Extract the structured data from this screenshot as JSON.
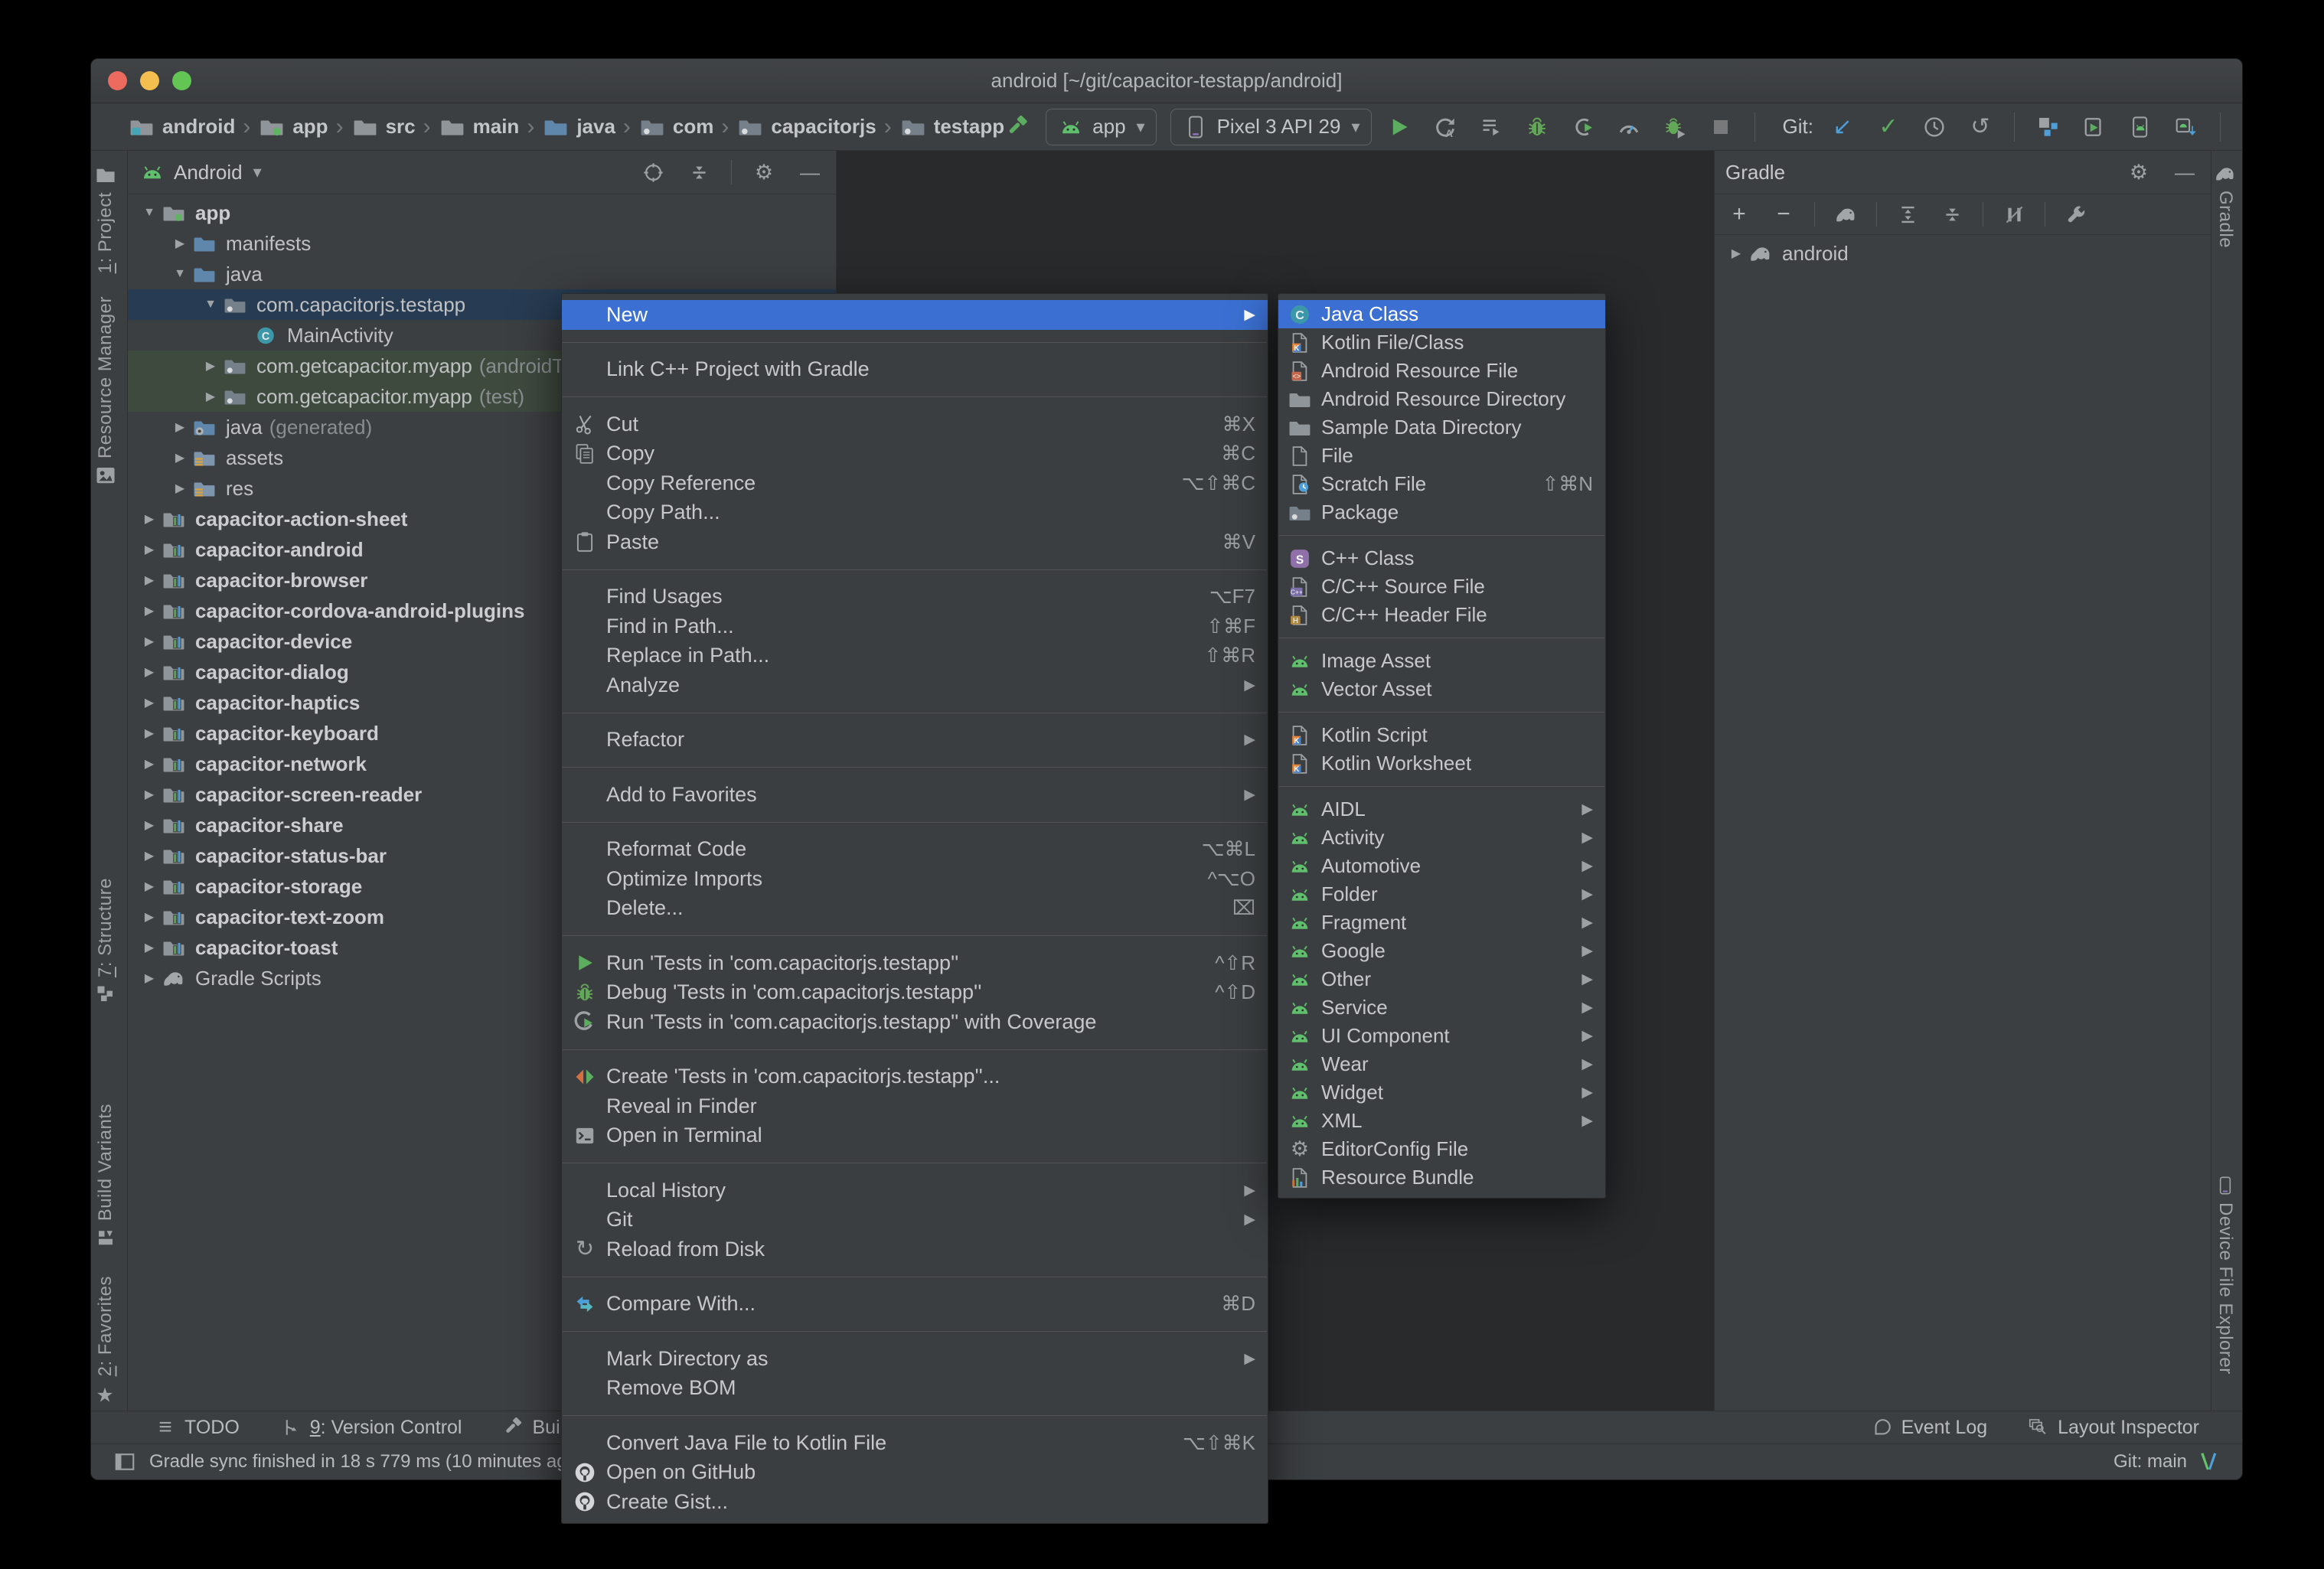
{
  "window": {
    "title": "android [~/git/capacitor-testapp/android]"
  },
  "breadcrumbs": [
    {
      "label": "android",
      "icon": "project-folder"
    },
    {
      "label": "app",
      "icon": "module-folder"
    },
    {
      "label": "src",
      "icon": "folder"
    },
    {
      "label": "main",
      "icon": "folder"
    },
    {
      "label": "java",
      "icon": "folder-blue"
    },
    {
      "label": "com",
      "icon": "package"
    },
    {
      "label": "capacitorjs",
      "icon": "package"
    },
    {
      "label": "testapp",
      "icon": "package"
    }
  ],
  "run_toolbar": {
    "config_label": "app",
    "device_label": "Pixel 3 API 29",
    "git_label": "Git:",
    "actions": [
      {
        "name": "run",
        "icon": "play"
      },
      {
        "name": "apply-changes",
        "icon": "apply"
      },
      {
        "name": "apply-code-changes",
        "icon": "list-restart"
      },
      {
        "name": "debug",
        "icon": "debug-bug"
      },
      {
        "name": "attach-debugger",
        "icon": "attach"
      },
      {
        "name": "profile",
        "icon": "gauge"
      },
      {
        "name": "rerun-with-coverage",
        "icon": "bug-rerun"
      },
      {
        "name": "stop",
        "icon": "stop"
      }
    ],
    "git_actions": [
      {
        "name": "update-project",
        "icon": "arrow-dl"
      },
      {
        "name": "commit",
        "icon": "check"
      },
      {
        "name": "show-history",
        "icon": "clock"
      },
      {
        "name": "rollback",
        "icon": "undo"
      }
    ],
    "tool_actions": [
      {
        "name": "project-structure",
        "icon": "structure"
      },
      {
        "name": "device-manager",
        "icon": "device-manager"
      },
      {
        "name": "avd-manager",
        "icon": "avd"
      },
      {
        "name": "sdk-manager",
        "icon": "sdk"
      }
    ]
  },
  "project_panel": {
    "title": "Android",
    "header_actions": [
      {
        "name": "select-opened-file",
        "icon": "locate"
      },
      {
        "name": "collapse-all",
        "icon": "collapse-all"
      },
      {
        "name": "settings",
        "icon": "gear"
      },
      {
        "name": "hide",
        "icon": "minimize"
      }
    ],
    "tree": [
      {
        "label": "app",
        "icon": "module-folder",
        "arrow": "down",
        "level": 0,
        "bold": true
      },
      {
        "label": "manifests",
        "icon": "folder-blue",
        "arrow": "right",
        "level": 1
      },
      {
        "label": "java",
        "icon": "folder-blue",
        "arrow": "down",
        "level": 1
      },
      {
        "label": "com.capacitorjs.testapp",
        "icon": "package",
        "arrow": "down",
        "level": 2,
        "selected": true
      },
      {
        "label": "MainActivity",
        "icon": "class",
        "level": 3
      },
      {
        "label": "com.getcapacitor.myapp",
        "suffix": "(androidTest)",
        "icon": "package",
        "arrow": "right",
        "level": 2,
        "row": "test"
      },
      {
        "label": "com.getcapacitor.myapp",
        "suffix": "(test)",
        "icon": "package",
        "arrow": "right",
        "level": 2,
        "row": "test"
      },
      {
        "label": "java",
        "suffix": "(generated)",
        "icon": "folder-gen",
        "arrow": "right",
        "level": 1
      },
      {
        "label": "assets",
        "icon": "folder-assets",
        "arrow": "right",
        "level": 1
      },
      {
        "label": "res",
        "icon": "folder-assets",
        "arrow": "right",
        "level": 1
      },
      {
        "label": "capacitor-action-sheet",
        "icon": "module",
        "arrow": "right",
        "level": 0,
        "bold": true
      },
      {
        "label": "capacitor-android",
        "icon": "module",
        "arrow": "right",
        "level": 0,
        "bold": true
      },
      {
        "label": "capacitor-browser",
        "icon": "module",
        "arrow": "right",
        "level": 0,
        "bold": true
      },
      {
        "label": "capacitor-cordova-android-plugins",
        "icon": "module",
        "arrow": "right",
        "level": 0,
        "bold": true
      },
      {
        "label": "capacitor-device",
        "icon": "module",
        "arrow": "right",
        "level": 0,
        "bold": true
      },
      {
        "label": "capacitor-dialog",
        "icon": "module",
        "arrow": "right",
        "level": 0,
        "bold": true
      },
      {
        "label": "capacitor-haptics",
        "icon": "module",
        "arrow": "right",
        "level": 0,
        "bold": true
      },
      {
        "label": "capacitor-keyboard",
        "icon": "module",
        "arrow": "right",
        "level": 0,
        "bold": true
      },
      {
        "label": "capacitor-network",
        "icon": "module",
        "arrow": "right",
        "level": 0,
        "bold": true
      },
      {
        "label": "capacitor-screen-reader",
        "icon": "module",
        "arrow": "right",
        "level": 0,
        "bold": true
      },
      {
        "label": "capacitor-share",
        "icon": "module",
        "arrow": "right",
        "level": 0,
        "bold": true
      },
      {
        "label": "capacitor-status-bar",
        "icon": "module",
        "arrow": "right",
        "level": 0,
        "bold": true
      },
      {
        "label": "capacitor-storage",
        "icon": "module",
        "arrow": "right",
        "level": 0,
        "bold": true
      },
      {
        "label": "capacitor-text-zoom",
        "icon": "module",
        "arrow": "right",
        "level": 0,
        "bold": true
      },
      {
        "label": "capacitor-toast",
        "icon": "module",
        "arrow": "right",
        "level": 0,
        "bold": true
      },
      {
        "label": "Gradle Scripts",
        "icon": "gradle-elephant",
        "arrow": "right",
        "level": 0
      }
    ]
  },
  "gradle_panel": {
    "title": "Gradle",
    "toolbar": [
      {
        "name": "refresh-add",
        "icon": "plus"
      },
      {
        "name": "detach",
        "icon": "minus"
      },
      {
        "name": "execute-task",
        "icon": "gradle-elephant"
      },
      {
        "name": "expand-all",
        "icon": "expand-all"
      },
      {
        "name": "collapse-all",
        "icon": "collapse-all"
      },
      {
        "name": "toggle-offline-mode",
        "icon": "offline"
      },
      {
        "name": "gradle-settings",
        "icon": "wrench"
      }
    ],
    "tree": [
      {
        "label": "android",
        "icon": "gradle-elephant",
        "arrow": "right",
        "level": 0
      }
    ]
  },
  "left_strip": [
    {
      "mnemonic": "1",
      "label": "Project",
      "icon": "project-tab"
    },
    {
      "label": "Resource Manager",
      "icon": "resource-tab"
    },
    {
      "mnemonic": "7",
      "label": "Structure",
      "icon": "structure-tab"
    },
    {
      "label": "Build Variants",
      "icon": "variants-tab"
    },
    {
      "mnemonic": "2",
      "label": "Favorites",
      "icon": "star"
    }
  ],
  "right_strip": [
    {
      "label": "Gradle",
      "icon": "gradle-elephant"
    },
    {
      "label": "Device File Explorer",
      "icon": "phone"
    }
  ],
  "context_menu": {
    "items": [
      {
        "label": "New",
        "submenu": true,
        "highlighted": true
      },
      {
        "sep": true
      },
      {
        "label": "Link C++ Project with Gradle"
      },
      {
        "sep": true
      },
      {
        "icon": "scissors",
        "label": "Cut",
        "shortcut": "⌘X"
      },
      {
        "icon": "copy",
        "label": "Copy",
        "shortcut": "⌘C"
      },
      {
        "label": "Copy Reference",
        "shortcut": "⌥⇧⌘C"
      },
      {
        "label": "Copy Path..."
      },
      {
        "icon": "paste",
        "label": "Paste",
        "shortcut": "⌘V"
      },
      {
        "sep": true
      },
      {
        "label": "Find Usages",
        "shortcut": "⌥F7"
      },
      {
        "label": "Find in Path...",
        "shortcut": "⇧⌘F"
      },
      {
        "label": "Replace in Path...",
        "shortcut": "⇧⌘R"
      },
      {
        "label": "Analyze",
        "submenu": true
      },
      {
        "sep": true
      },
      {
        "label": "Refactor",
        "submenu": true
      },
      {
        "sep": true
      },
      {
        "label": "Add to Favorites",
        "submenu": true
      },
      {
        "sep": true
      },
      {
        "label": "Reformat Code",
        "shortcut": "⌥⌘L"
      },
      {
        "label": "Optimize Imports",
        "shortcut": "^⌥O"
      },
      {
        "label": "Delete...",
        "shortcut": "⌧"
      },
      {
        "sep": true
      },
      {
        "icon": "run-green",
        "label": "Run 'Tests in 'com.capacitorjs.testapp''",
        "shortcut": "^⇧R"
      },
      {
        "icon": "debug-bug",
        "label": "Debug 'Tests in 'com.capacitorjs.testapp''",
        "shortcut": "^⇧D"
      },
      {
        "icon": "coverage",
        "label": "Run 'Tests in 'com.capacitorjs.testapp'' with Coverage"
      },
      {
        "sep": true
      },
      {
        "icon": "create-tests",
        "label": "Create 'Tests in 'com.capacitorjs.testapp''..."
      },
      {
        "label": "Reveal in Finder"
      },
      {
        "icon": "terminal",
        "label": "Open in Terminal"
      },
      {
        "sep": true
      },
      {
        "label": "Local History",
        "submenu": true
      },
      {
        "label": "Git",
        "submenu": true
      },
      {
        "icon": "reload",
        "label": "Reload from Disk"
      },
      {
        "sep": true
      },
      {
        "icon": "compare",
        "label": "Compare With...",
        "shortcut": "⌘D"
      },
      {
        "sep": true
      },
      {
        "label": "Mark Directory as",
        "submenu": true
      },
      {
        "label": "Remove BOM"
      },
      {
        "sep": true
      },
      {
        "label": "Convert Java File to Kotlin File",
        "shortcut": "⌥⇧⌘K"
      },
      {
        "icon": "github",
        "label": "Open on GitHub"
      },
      {
        "icon": "github",
        "label": "Create Gist..."
      }
    ]
  },
  "new_submenu": {
    "items": [
      {
        "icon": "java-class",
        "label": "Java Class",
        "highlighted": true
      },
      {
        "icon": "kotlin-file",
        "label": "Kotlin File/Class"
      },
      {
        "icon": "android-resource-file",
        "label": "Android Resource File"
      },
      {
        "icon": "folder",
        "label": "Android Resource Directory"
      },
      {
        "icon": "folder",
        "label": "Sample Data Directory"
      },
      {
        "icon": "file",
        "label": "File"
      },
      {
        "icon": "scratch-file",
        "label": "Scratch File",
        "shortcut": "⇧⌘N"
      },
      {
        "icon": "package",
        "label": "Package"
      },
      {
        "sep": true
      },
      {
        "icon": "cpp-class",
        "label": "C++ Class"
      },
      {
        "icon": "c-source",
        "label": "C/C++ Source File"
      },
      {
        "icon": "c-header",
        "label": "C/C++ Header File"
      },
      {
        "sep": true
      },
      {
        "icon": "android-head",
        "label": "Image Asset"
      },
      {
        "icon": "android-head",
        "label": "Vector Asset"
      },
      {
        "sep": true
      },
      {
        "icon": "kotlin-file",
        "label": "Kotlin Script"
      },
      {
        "icon": "kotlin-file",
        "label": "Kotlin Worksheet"
      },
      {
        "sep": true
      },
      {
        "icon": "android-head",
        "label": "AIDL",
        "submenu": true
      },
      {
        "icon": "android-head",
        "label": "Activity",
        "submenu": true
      },
      {
        "icon": "android-head",
        "label": "Automotive",
        "submenu": true
      },
      {
        "icon": "android-head",
        "label": "Folder",
        "submenu": true
      },
      {
        "icon": "android-head",
        "label": "Fragment",
        "submenu": true
      },
      {
        "icon": "android-head",
        "label": "Google",
        "submenu": true
      },
      {
        "icon": "android-head",
        "label": "Other",
        "submenu": true
      },
      {
        "icon": "android-head",
        "label": "Service",
        "submenu": true
      },
      {
        "icon": "android-head",
        "label": "UI Component",
        "submenu": true
      },
      {
        "icon": "android-head",
        "label": "Wear",
        "submenu": true
      },
      {
        "icon": "android-head",
        "label": "Widget",
        "submenu": true
      },
      {
        "icon": "android-head",
        "label": "XML",
        "submenu": true
      },
      {
        "icon": "gear",
        "label": "EditorConfig File"
      },
      {
        "icon": "resource-bundle",
        "label": "Resource Bundle"
      }
    ]
  },
  "bottom_bar": {
    "left": [
      {
        "icon": "todo",
        "label": "TODO"
      },
      {
        "icon": "branch",
        "mnemonic": "9",
        "label": "Version Control"
      },
      {
        "icon": "hammer",
        "label": "Build"
      }
    ],
    "right": [
      {
        "icon": "balloon",
        "label": "Event Log"
      },
      {
        "icon": "inspector",
        "label": "Layout Inspector"
      }
    ]
  },
  "status_bar": {
    "message": "Gradle sync finished in 18 s 779 ms (10 minutes ago)",
    "git_branch": "Git: main"
  },
  "colors": {
    "selection_blue": "#3B70D2",
    "tree_selected_row": "#273B52",
    "test_source_row": "#3F4A3F",
    "android_green": "#5FBF6C",
    "run_green": "#5CAD5F",
    "git_blue": "#4E9FD8",
    "panel_bg": "#3C3F41",
    "editor_bg": "#282A2C"
  }
}
